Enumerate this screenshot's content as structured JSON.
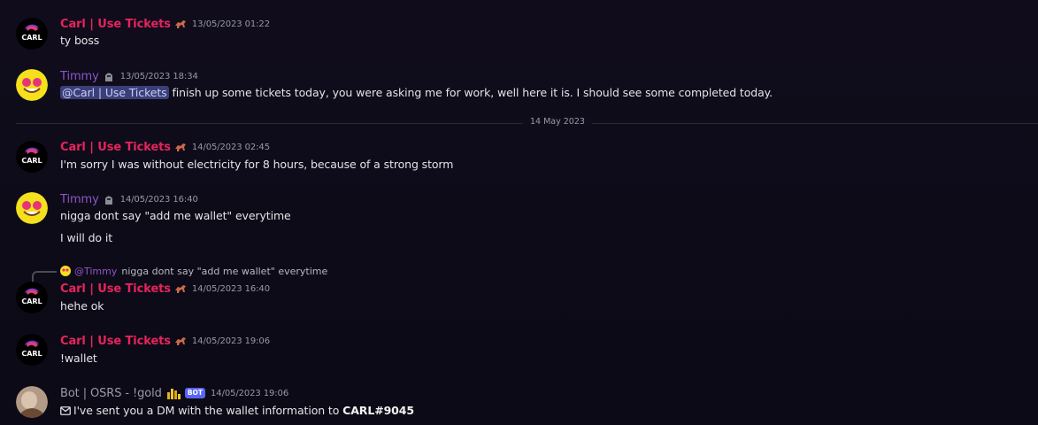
{
  "divider": {
    "label": "14 May 2023"
  },
  "messages": [
    {
      "author": "Carl | Use Tickets",
      "timestamp": "13/05/2023 01:22",
      "avatar_text": "CARL",
      "lines": [
        "ty boss"
      ]
    },
    {
      "author": "Timmy",
      "timestamp": "13/05/2023 18:34",
      "mention": "@Carl | Use Tickets",
      "lines": [
        " finish up some tickets today, you were asking me for work, well here it is. I should see some completed today."
      ]
    },
    {
      "author": "Carl | Use Tickets",
      "timestamp": "14/05/2023 02:45",
      "avatar_text": "CARL",
      "lines": [
        "I'm sorry I was without electricity for 8 hours, because of a strong storm"
      ]
    },
    {
      "author": "Timmy",
      "timestamp": "14/05/2023 16:40",
      "lines": [
        "nigga dont say \"add me wallet\" everytime",
        "I will do it"
      ]
    },
    {
      "author": "Carl | Use Tickets",
      "timestamp": "14/05/2023 16:40",
      "avatar_text": "CARL",
      "lines": [
        "hehe ok"
      ],
      "reply": {
        "author": "@Timmy",
        "text": "nigga dont say \"add me wallet\" everytime"
      }
    },
    {
      "author": "Carl | Use Tickets",
      "timestamp": "14/05/2023 19:06",
      "avatar_text": "CARL",
      "lines": [
        "!wallet"
      ]
    },
    {
      "author": "Bot | OSRS - !gold",
      "timestamp": "14/05/2023 19:06",
      "bot_tag": "BOT",
      "text_prefix": "I've sent you a DM with the wallet information to ",
      "text_strong": "CARL#9045"
    }
  ],
  "colors": {
    "carl": "#e5245c",
    "timmy": "#8e55c9",
    "bot": "#9a99a6",
    "mention_bg": "#3b3f78",
    "bot_tag": "#5865f2"
  },
  "icons": [
    "carl-avatar",
    "timmy-avatar",
    "bot-avatar",
    "horse-role-icon",
    "knight-role-icon",
    "gold-role-icon",
    "envelope-icon"
  ]
}
